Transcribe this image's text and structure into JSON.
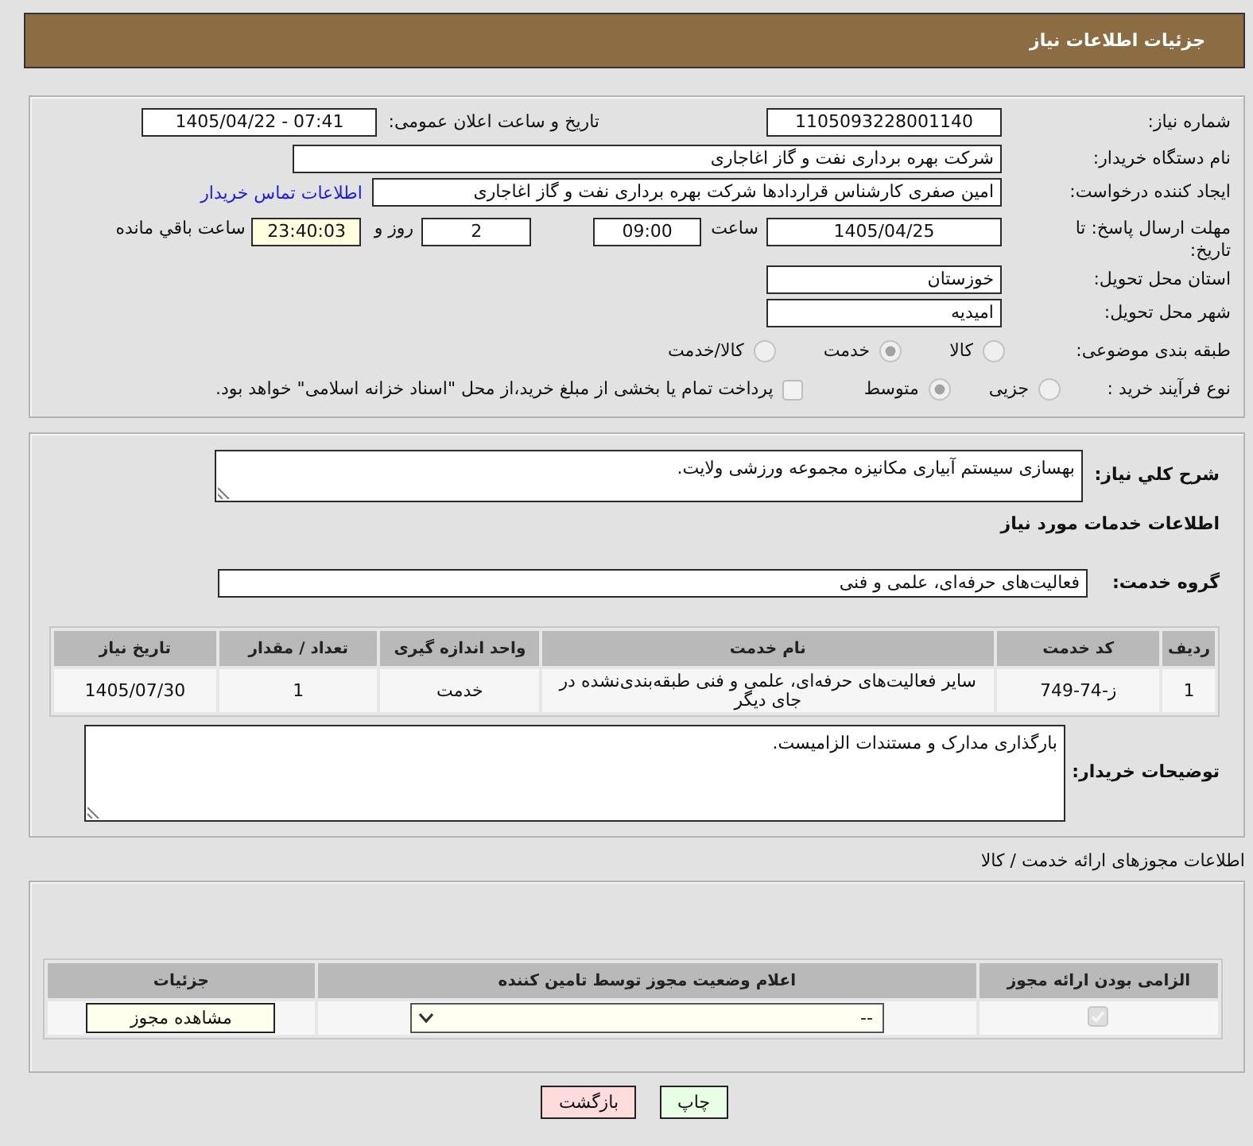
{
  "header": {
    "title": "جزئیات اطلاعات نیاز"
  },
  "details": {
    "need_number": {
      "label": "شماره نیاز:",
      "value": "1105093228001140"
    },
    "announce": {
      "label": "تاریخ و ساعت اعلان عمومی:",
      "value": "1405/04/22 - 07:41"
    },
    "buyer": {
      "label": "نام دستگاه خریدار:",
      "value": "شرکت بهره برداری نفت و گاز اغاجاری"
    },
    "requester": {
      "label": "ایجاد کننده درخواست:",
      "value": "امین صفری کارشناس قراردادها شرکت بهره برداری نفت و گاز اغاجاری",
      "contact_link": "اطلاعات تماس خریدار"
    },
    "deadline": {
      "label": "مهلت ارسال پاسخ: تا تاریخ:",
      "date": "1405/04/25",
      "time_label": "ساعت",
      "time": "09:00",
      "days": "2",
      "days_label": "روز و",
      "remaining": "23:40:03",
      "remaining_label": "ساعت باقي مانده"
    },
    "province": {
      "label": "استان محل تحویل:",
      "value": "خوزستان"
    },
    "city": {
      "label": "شهر محل تحویل:",
      "value": "امیدیه"
    },
    "category": {
      "label": "طبقه بندی موضوعی:",
      "options": [
        {
          "label": "کالا",
          "selected": false
        },
        {
          "label": "خدمت",
          "selected": true
        },
        {
          "label": "کالا/خدمت",
          "selected": false
        }
      ]
    },
    "process": {
      "label": "نوع فرآیند خرید :",
      "options": [
        {
          "label": "جزیی",
          "selected": false
        },
        {
          "label": "متوسط",
          "selected": true
        }
      ],
      "treasury": {
        "label": "پرداخت تمام یا بخشی از مبلغ خرید،از محل \"اسناد خزانه اسلامی\" خواهد بود.",
        "checked": false
      }
    }
  },
  "need": {
    "summary": {
      "label": "شرح كلي نياز:",
      "value": "بهسازی سیستم آبیاری مکانیزه مجموعه ورزشی ولایت."
    },
    "services_title": "اطلاعات خدمات مورد نیاز",
    "service_group": {
      "label": "گروه خدمت:",
      "value": "فعالیت‌های حرفه‌ای، علمی و فنی"
    },
    "table": {
      "columns": [
        "ردیف",
        "کد خدمت",
        "نام خدمت",
        "واحد اندازه گیری",
        "تعداد / مقدار",
        "تاریخ نیاز"
      ],
      "rows": [
        [
          "1",
          "ز-74-749",
          "سایر فعالیت‌های حرفه‌ای، علمی و فنی طبقه‌بندی‌نشده در جای دیگر",
          "خدمت",
          "1",
          "1405/07/30"
        ]
      ]
    },
    "buyer_notes": {
      "label": "توضیحات خریدار:",
      "value": "بارگذاری مدارک و مستندات الزامیست."
    }
  },
  "permits": {
    "title": "اطلاعات مجوزهای ارائه خدمت / کالا",
    "columns": [
      "الزامی بودن ارائه مجوز",
      "اعلام وضعیت مجوز توسط تامین کننده",
      "جزئیات"
    ],
    "rows": [
      {
        "required": {
          "checked": true
        },
        "status": "--",
        "details_button": "مشاهده مجوز"
      }
    ]
  },
  "buttons": [
    {
      "kind": "print",
      "label": "چاپ"
    },
    {
      "kind": "back",
      "label": "بازگشت"
    }
  ]
}
